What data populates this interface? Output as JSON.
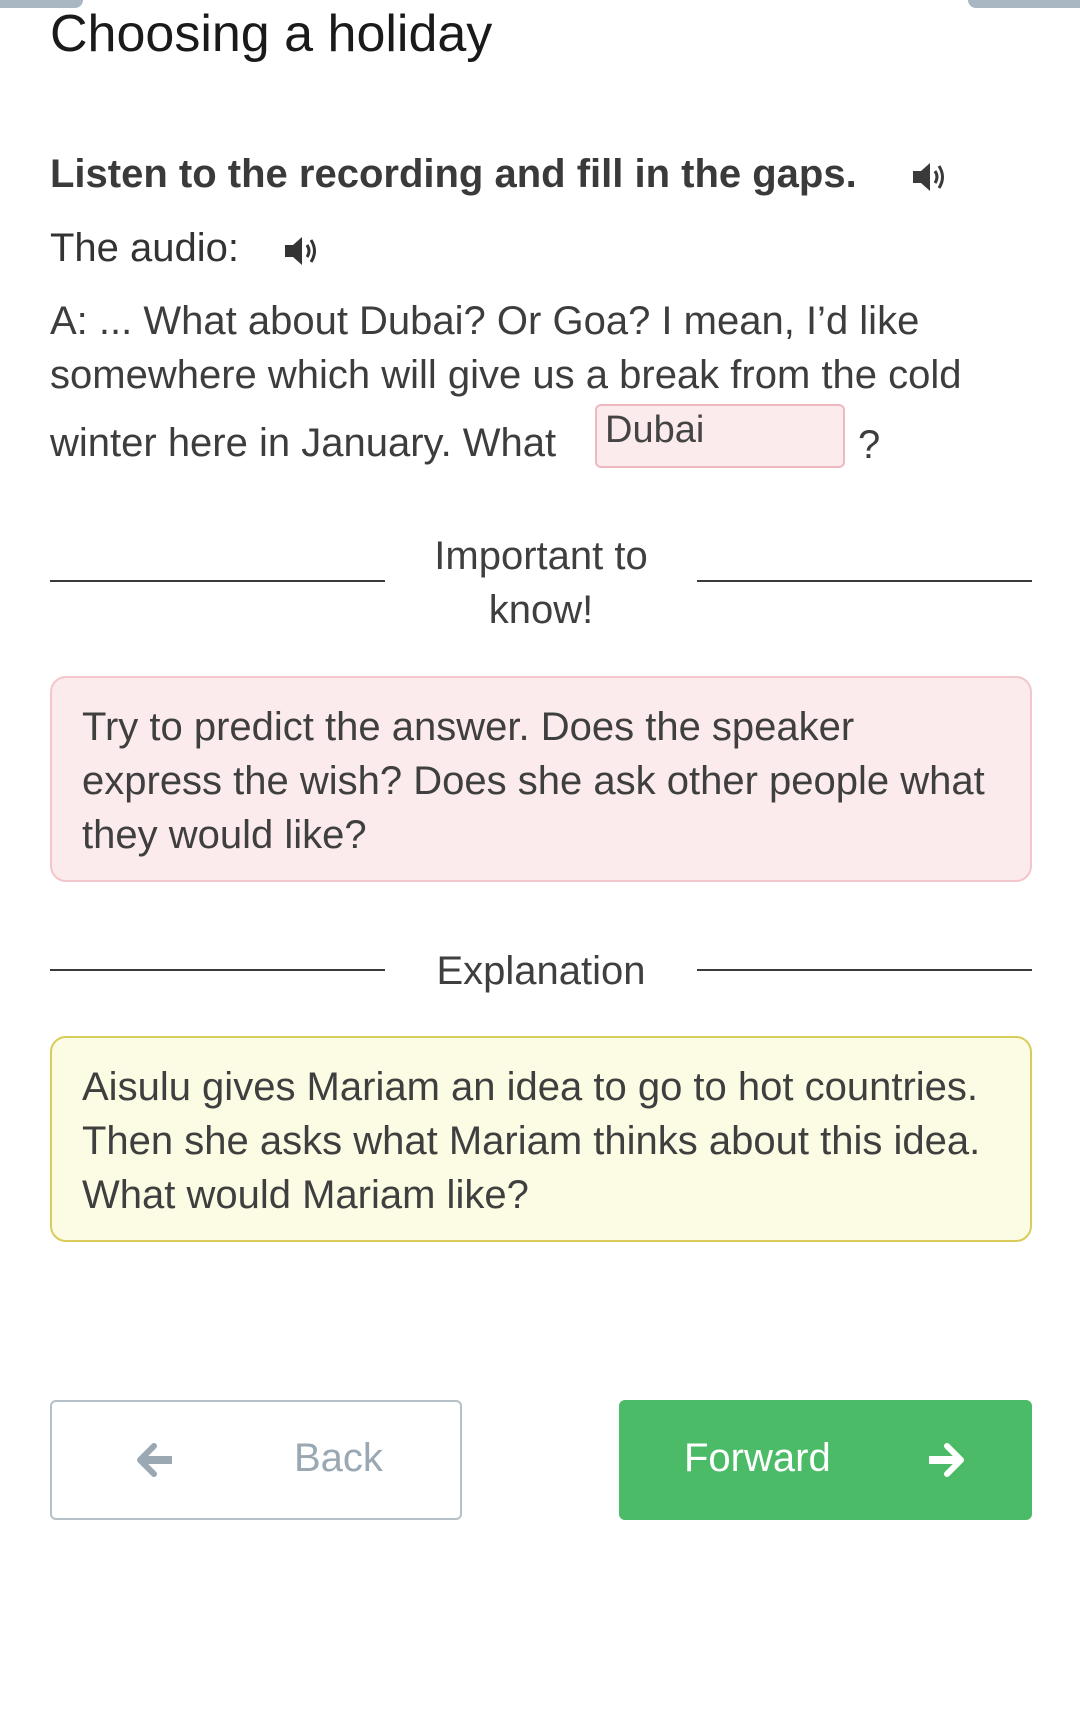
{
  "page": {
    "title": "Choosing a holiday"
  },
  "task": {
    "instruction": "Listen to the recording and fill in the gaps.",
    "audio_label": "The audio:"
  },
  "passage": {
    "line1": "A: ... What about Dubai? Or Goa? I mean, I’d like",
    "line2": "somewhere which will give us a break from the cold",
    "line3_pre": "winter here in January. What",
    "gap_value": "Dubai",
    "line3_post": "?"
  },
  "important": {
    "heading_line1": "Important to",
    "heading_line2": "know!",
    "text": "Try to predict the answer. Does the speaker express the wish? Does she ask other people what they would like?"
  },
  "explanation": {
    "heading": "Explanation",
    "text": "Aisulu gives Mariam an idea to go to hot countries. Then she asks what Mariam thinks about this idea. What would Mariam like?"
  },
  "navigation": {
    "back_label": "Back",
    "forward_label": "Forward"
  },
  "colors": {
    "forward_button": "#4cbb67",
    "gap_background": "#fbebec",
    "important_background": "#fbebec",
    "explanation_background": "#fcfbe4"
  },
  "icons": {
    "instruction_audio": "speaker-icon",
    "audio_player": "speaker-icon",
    "back": "arrow-left-icon",
    "forward": "arrow-right-icon"
  }
}
